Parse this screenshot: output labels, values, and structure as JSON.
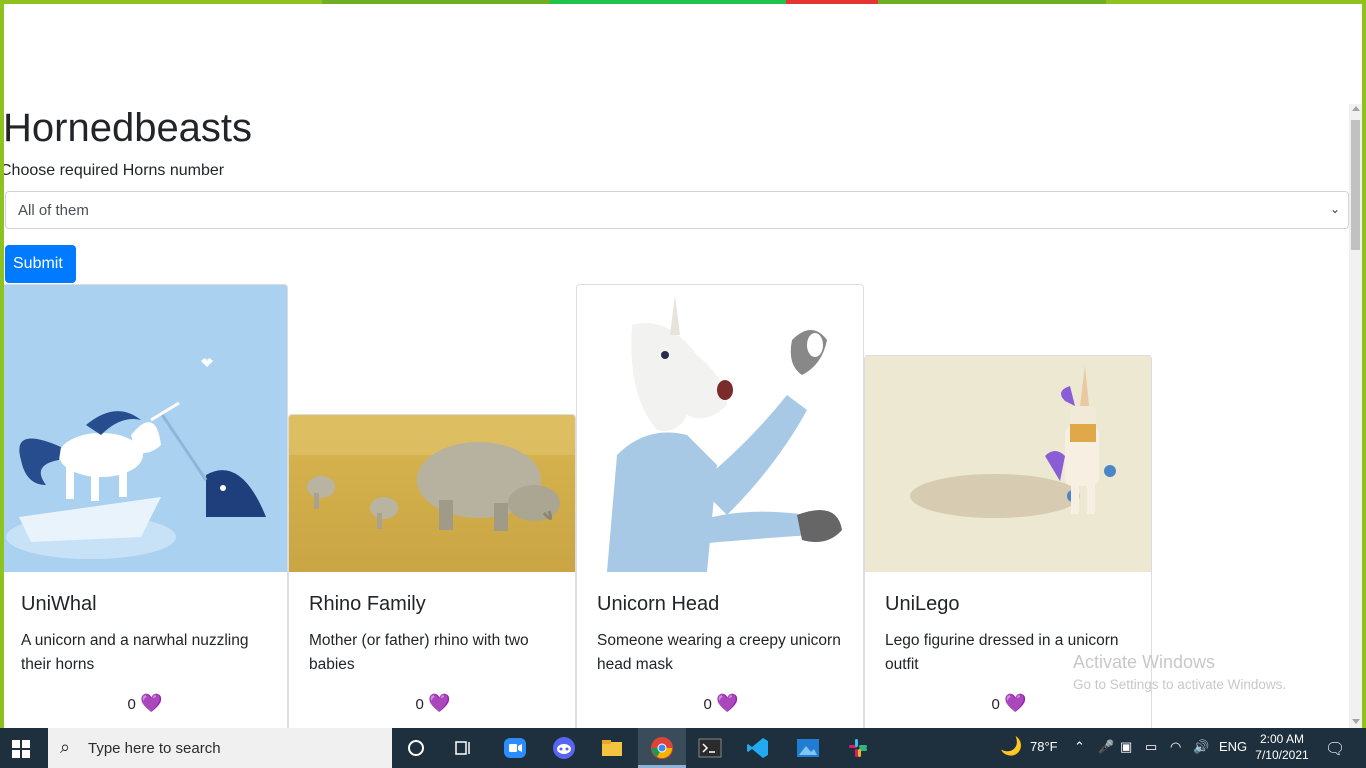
{
  "page": {
    "title": "Hornedbeasts",
    "filter_label": "Choose required Horns number",
    "filter_selected": "All of them",
    "submit_label": "Submit"
  },
  "cards": [
    {
      "title": "UniWhal",
      "description": "A unicorn and a narwhal nuzzling their horns",
      "votes": "0"
    },
    {
      "title": "Rhino Family",
      "description": "Mother (or father) rhino with two babies",
      "votes": "0"
    },
    {
      "title": "Unicorn Head",
      "description": "Someone wearing a creepy unicorn head mask",
      "votes": "0"
    },
    {
      "title": "UniLego",
      "description": "Lego figurine dressed in a unicorn outfit",
      "votes": "0"
    }
  ],
  "watermark": {
    "line1": "Activate Windows",
    "line2": "Go to Settings to activate Windows."
  },
  "taskbar": {
    "search_placeholder": "Type here to search",
    "weather": "78°F",
    "language": "ENG",
    "time": "2:00 AM",
    "date": "7/10/2021"
  },
  "colors": {
    "frame": "#8dc21f",
    "primary_button": "#007bff",
    "heart": "#8a5cd6",
    "taskbar": "#1e2f3d"
  }
}
